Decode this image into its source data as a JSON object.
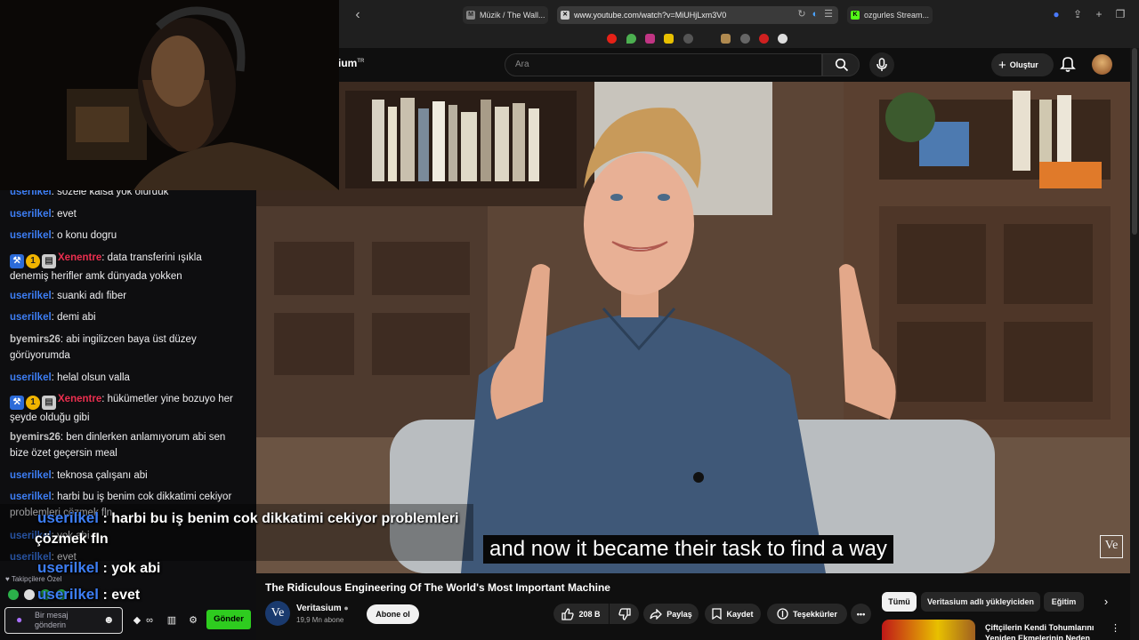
{
  "browser": {
    "tabs": [
      {
        "title": "Müzik / The Wall...",
        "icon": "m-icon"
      },
      {
        "title": "www.youtube.com/watch?v=MiUHjLxm3V0",
        "icon": "x-icon"
      },
      {
        "title": "ozgurles Stream...",
        "icon": "kick-icon"
      }
    ]
  },
  "youtube": {
    "logo_fragment": "ium",
    "logo_tm": "TR",
    "search_placeholder": "Ara",
    "create_label": "Oluştur",
    "video": {
      "caption": "and now it became their task to find a way",
      "watermark": "Ve",
      "title": "The Ridiculous Engineering Of The World's Most Important Machine"
    },
    "channel": {
      "avatar_text": "Ve",
      "name": "Veritasium",
      "subs": "19,9 Mn abone",
      "subscribe_label": "Abone ol"
    },
    "actions": {
      "likes": "208 B",
      "share": "Paylaş",
      "save": "Kaydet",
      "thanks": "Teşekkürler"
    },
    "chips": [
      "Tümü",
      "Veritasium adlı yükleyiciden",
      "Eğitim"
    ],
    "recommended": {
      "title": "Çiftçilerin Kendi Tohumlarını Yeniden Ekmelerinin Neden"
    }
  },
  "chat": {
    "messages": [
      {
        "user": "userilkel",
        "text": "sözele kalsa yok olurduk"
      },
      {
        "user": "userilkel",
        "text": "evet"
      },
      {
        "user": "userilkel",
        "text": "o konu dogru"
      },
      {
        "user": "Xenentre",
        "text": "data transferini ışıkla denemiş herifler amk dünyada yokken"
      },
      {
        "user": "userilkel",
        "text": "suanki adı fiber"
      },
      {
        "user": "userilkel",
        "text": "demi abi"
      },
      {
        "user": "byemirs26",
        "text": "abi ingilizcen baya üst düzey görüyorumda"
      },
      {
        "user": "userilkel",
        "text": "helal olsun valla"
      },
      {
        "user": "Xenentre",
        "text": "hükümetler yine bozuyo her şeyde olduğu gibi"
      },
      {
        "user": "byemirs26",
        "text": "ben dinlerken anlamıyorum abi sen bize özet geçersin meal"
      },
      {
        "user": "userilkel",
        "text": "teknosa çalışanı abi"
      },
      {
        "user": "userilkel",
        "text": "harbi bu iş benim cok dikkatimi cekiyor problemleri çözmek fln"
      },
      {
        "user": "userilkel",
        "text": "yok abi"
      },
      {
        "user": "userilkel",
        "text": "evet"
      }
    ],
    "badge_number": "1",
    "followers_only": "Takipçilere Özel",
    "input_placeholder": "Bir mesaj gönderin",
    "send_label": "Gönder"
  },
  "overlay": {
    "line1_user": "userilkel",
    "line1_text": ": harbi bu iş benim cok dikkatimi cekiyor problemleri",
    "line1_cont": "çözmek fln",
    "line2_user": "userilkel",
    "line2_text": ": yok abi",
    "line3_user": "userilkel",
    "line3_text": ": evet"
  },
  "colors": {
    "username_blue": "#3d7ef5",
    "username_red": "#eb2f4f",
    "send_green": "#2ecc1f",
    "twitch_purple": "#a970ff"
  }
}
